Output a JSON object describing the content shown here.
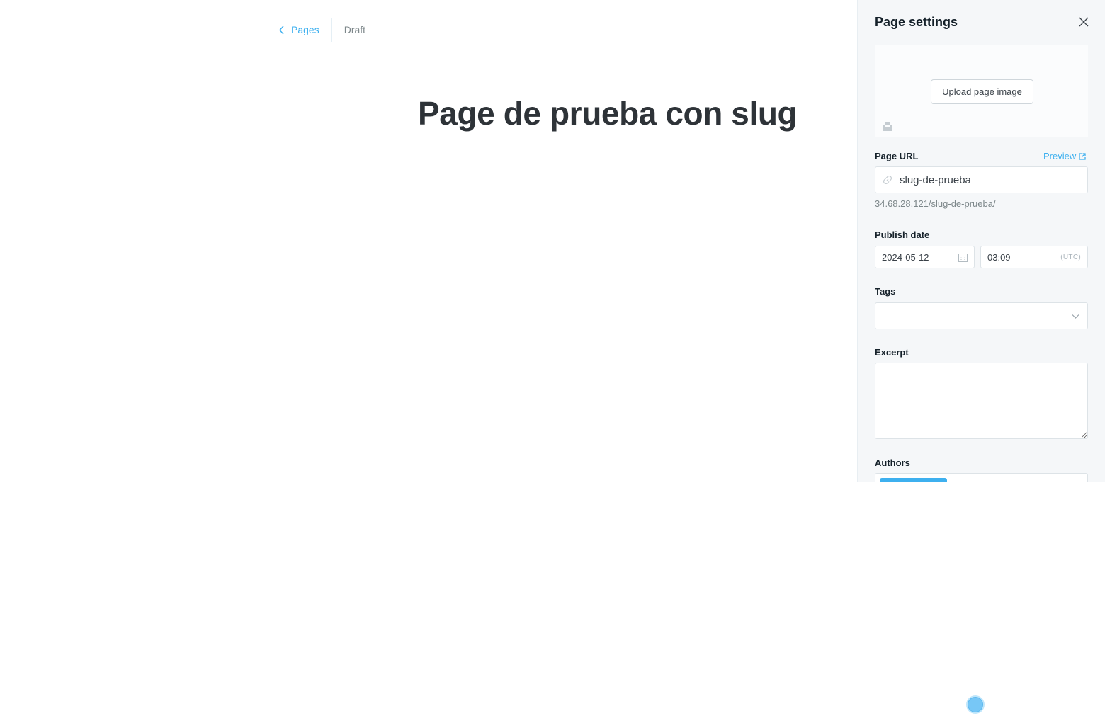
{
  "editor": {
    "back_label": "Pages",
    "status": "Draft",
    "title": "Page de prueba con slug"
  },
  "settings": {
    "title": "Page settings",
    "upload_label": "Upload page image",
    "page_url_label": "Page URL",
    "preview_label": "Preview",
    "slug": "slug-de-prueba",
    "url_help": "34.68.28.121/slug-de-prueba/",
    "publish_date_label": "Publish date",
    "date": "2024-05-12",
    "time": "03:09",
    "timezone": "(UTC)",
    "tags_label": "Tags",
    "excerpt_label": "Excerpt",
    "authors_label": "Authors"
  },
  "colors": {
    "accent": "#3eb0ef",
    "panel_bg": "#f5f7f9",
    "title": "#2e3338"
  },
  "icons": [
    "chevron-left-icon",
    "close-icon",
    "unsplash-icon",
    "external-link-icon",
    "link-icon",
    "calendar-icon",
    "chevron-down-icon"
  ]
}
